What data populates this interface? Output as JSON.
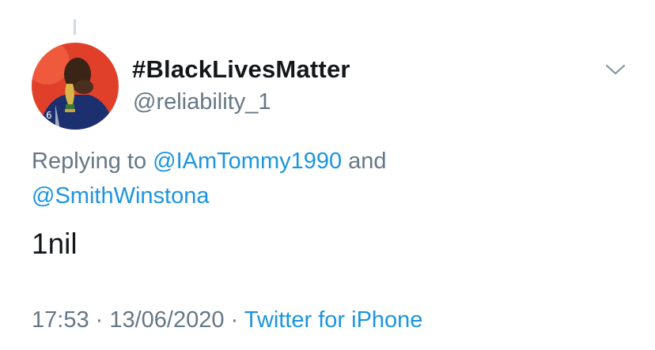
{
  "user": {
    "display_name": "#BlackLivesMatter",
    "handle": "@reliability_1"
  },
  "reply": {
    "prefix": "Replying to ",
    "mention_1": "@IAmTommy1990",
    "conjunction": " and ",
    "mention_2": "@SmithWinstona"
  },
  "tweet": {
    "text": "1nil"
  },
  "meta": {
    "time": "17:53",
    "separator_1": " · ",
    "date": "13/06/2020",
    "separator_2": " · ",
    "source": "Twitter for iPhone"
  },
  "icons": {
    "menu": "chevron-down-icon"
  },
  "colors": {
    "text_primary": "#14171a",
    "text_secondary": "#657786",
    "link": "#1b95e0",
    "avatar_background": "#e0402a"
  }
}
